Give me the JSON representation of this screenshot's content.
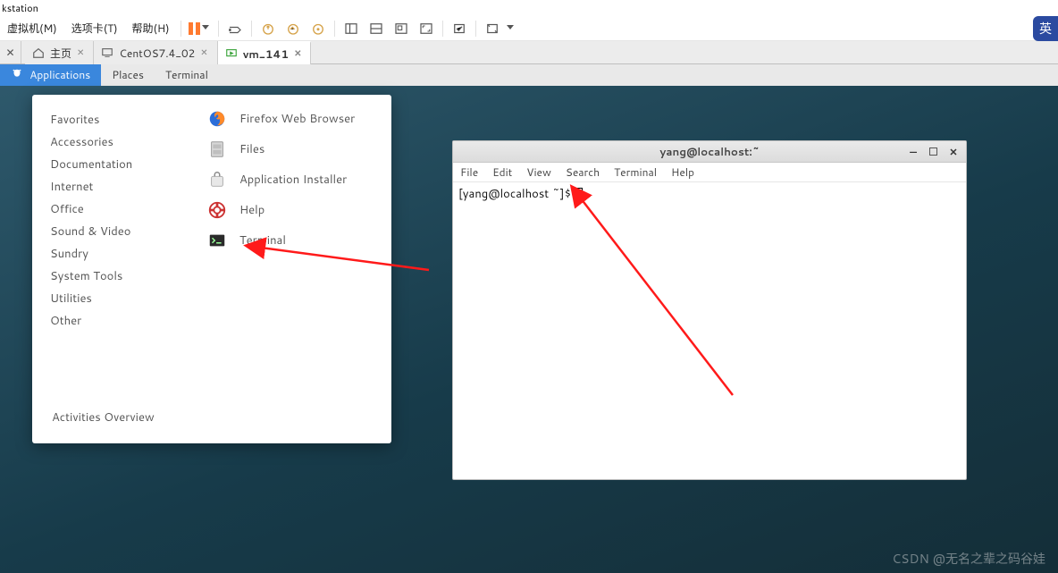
{
  "window": {
    "title_fragment": "kstation"
  },
  "vm_menu": {
    "items": [
      "虚拟机(M)",
      "选项卡(T)",
      "帮助(H)"
    ]
  },
  "ime_badge": "英",
  "tabs": {
    "home": "主页",
    "centos": "CentOS7.4_02",
    "vm141": "vm_141"
  },
  "gnome_bar": {
    "applications": "Applications",
    "places": "Places",
    "terminal": "Terminal"
  },
  "app_menu": {
    "categories": [
      "Favorites",
      "Accessories",
      "Documentation",
      "Internet",
      "Office",
      "Sound & Video",
      "Sundry",
      "System Tools",
      "Utilities",
      "Other"
    ],
    "activities": "Activities Overview",
    "apps": {
      "firefox": "Firefox Web Browser",
      "files": "Files",
      "installer": "Application Installer",
      "help": "Help",
      "terminal": "Terminal"
    }
  },
  "terminal": {
    "title": "yang@localhost:~",
    "menu": [
      "File",
      "Edit",
      "View",
      "Search",
      "Terminal",
      "Help"
    ],
    "prompt": "[yang@localhost ~]$ "
  },
  "watermark": "CSDN @无名之辈之码谷娃"
}
